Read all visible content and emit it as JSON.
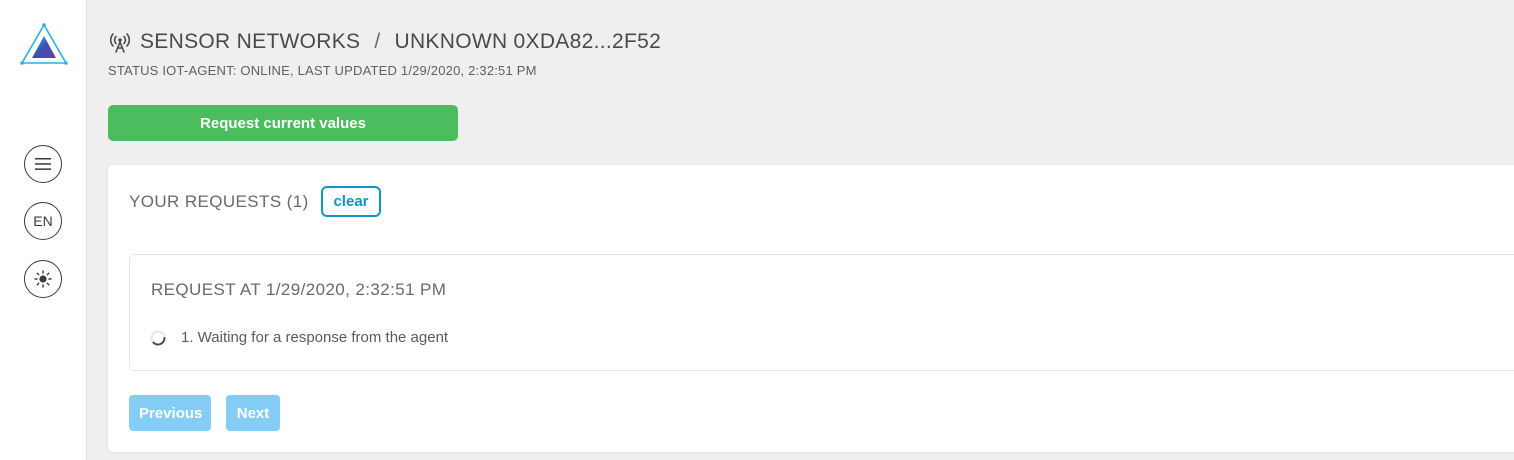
{
  "sidebar": {
    "logo_icon": "triangle-logo-icon",
    "menu_icon": "hamburger-menu-icon",
    "language": "EN",
    "theme_icon": "sun-icon"
  },
  "header": {
    "icon": "antenna-icon",
    "section": "SENSOR NETWORKS",
    "separator": "/",
    "device": "UNKNOWN 0XDA82...2F52",
    "status": "STATUS IOT-AGENT: ONLINE, LAST UPDATED 1/29/2020, 2:32:51 PM"
  },
  "actions": {
    "request_label": "Request current values"
  },
  "requests": {
    "title": "YOUR REQUESTS (1)",
    "clear_label": "clear",
    "items": [
      {
        "time": "REQUEST AT 1/29/2020, 2:32:51 PM",
        "step": "1. Waiting for a response from the agent"
      }
    ]
  },
  "pagination": {
    "previous_label": "Previous",
    "next_label": "Next"
  },
  "colors": {
    "primary_green": "#4bbd5e",
    "accent_blue": "#1193c8",
    "pager_blue": "#84cdf6",
    "background": "#efefef"
  }
}
